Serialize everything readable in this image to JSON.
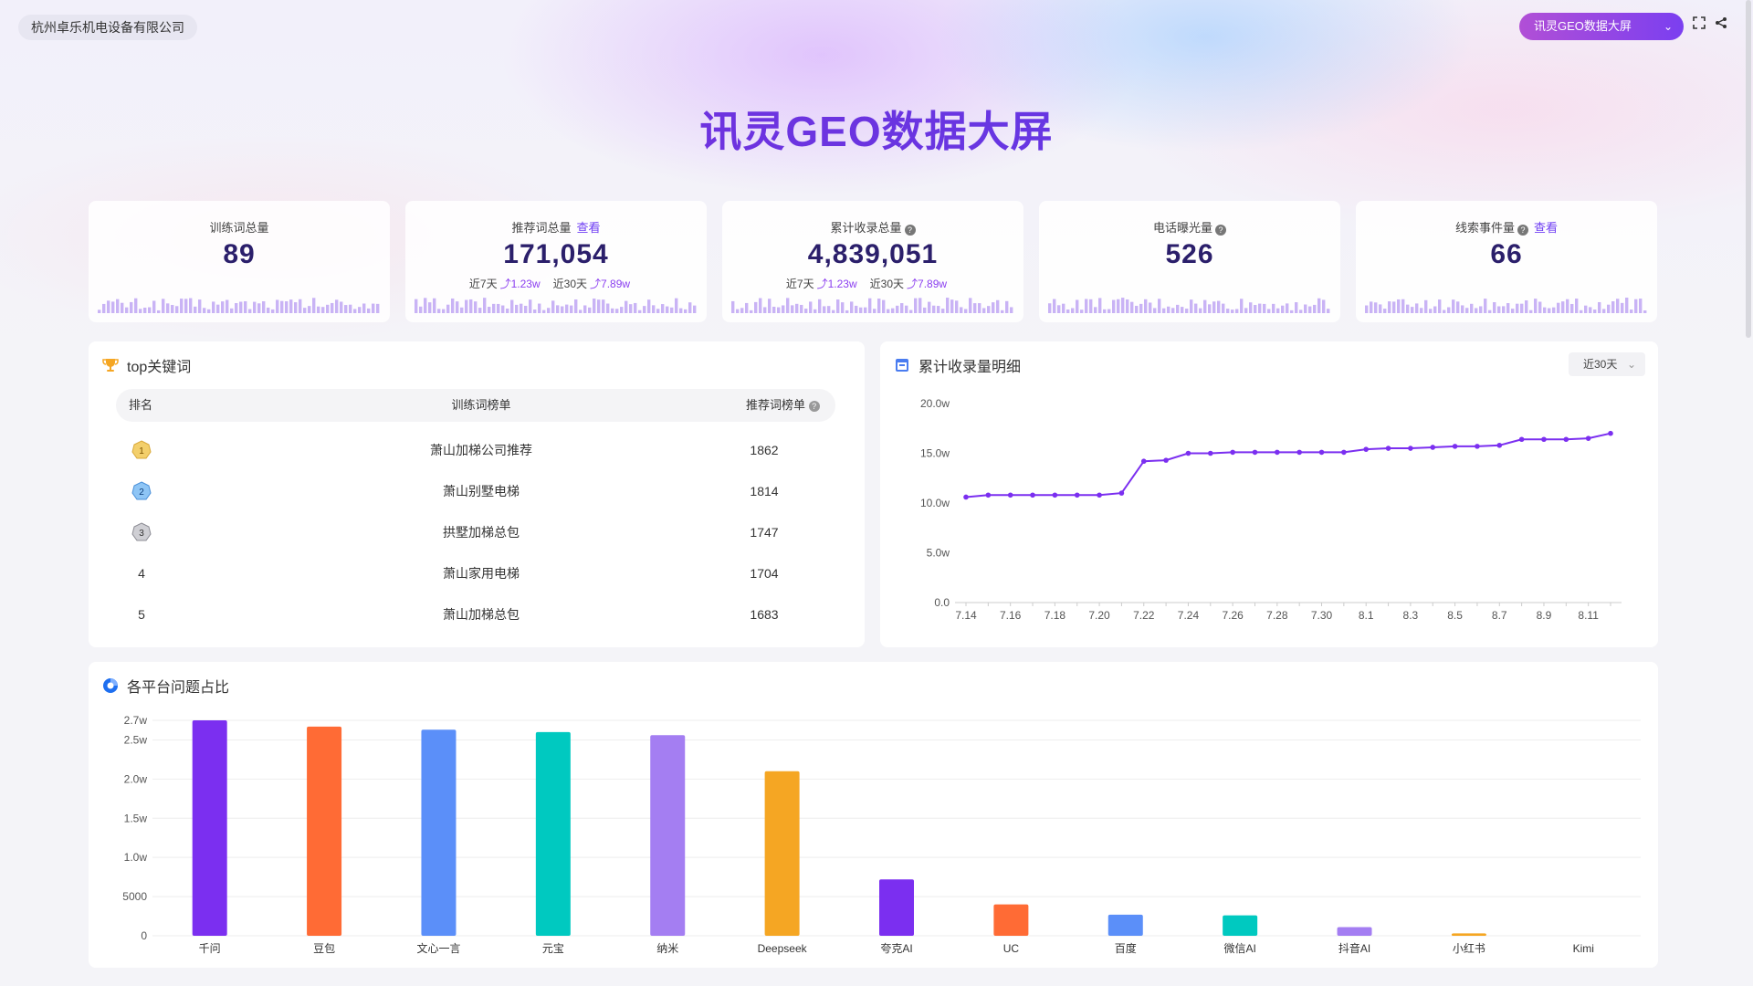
{
  "header": {
    "company": "杭州卓乐机电设备有限公司",
    "screen_select": "讯灵GEO数据大屏",
    "title": "讯灵GEO数据大屏"
  },
  "kpis": [
    {
      "label": "训练词总量",
      "value": "89",
      "link": "",
      "help": false,
      "trend": null
    },
    {
      "label": "推荐词总量",
      "value": "171,054",
      "link": "查看",
      "help": false,
      "trend": {
        "d7_label": "近7天",
        "d7_value": "1.23w",
        "d30_label": "近30天",
        "d30_value": "7.89w"
      }
    },
    {
      "label": "累计收录总量",
      "value": "4,839,051",
      "link": "",
      "help": true,
      "trend": {
        "d7_label": "近7天",
        "d7_value": "1.23w",
        "d30_label": "近30天",
        "d30_value": "7.89w"
      }
    },
    {
      "label": "电话曝光量",
      "value": "526",
      "link": "",
      "help": true,
      "trend": null
    },
    {
      "label": "线索事件量",
      "value": "66",
      "link": "查看",
      "help": true,
      "trend": null
    }
  ],
  "top_keywords": {
    "title": "top关键词",
    "columns": {
      "rank": "排名",
      "keyword": "训练词榜单",
      "count": "推荐词榜单"
    },
    "rows": [
      {
        "rank": "1",
        "keyword": "萧山加梯公司推荐",
        "count": "1862"
      },
      {
        "rank": "2",
        "keyword": "萧山别墅电梯",
        "count": "1814"
      },
      {
        "rank": "3",
        "keyword": "拱墅加梯总包",
        "count": "1747"
      },
      {
        "rank": "4",
        "keyword": "萧山家用电梯",
        "count": "1704"
      },
      {
        "rank": "5",
        "keyword": "萧山加梯总包",
        "count": "1683"
      }
    ]
  },
  "collection_panel": {
    "title": "累计收录量明细",
    "range": "近30天"
  },
  "platform_panel": {
    "title": "各平台问题占比"
  },
  "colors": {
    "accent": "#7b2ff0",
    "line": "#7b2ff0",
    "spark": "#c9b3f5"
  },
  "chart_data": [
    {
      "type": "line",
      "x": [
        "7.14",
        "7.15",
        "7.16",
        "7.17",
        "7.18",
        "7.19",
        "7.20",
        "7.21",
        "7.22",
        "7.23",
        "7.24",
        "7.25",
        "7.26",
        "7.27",
        "7.28",
        "7.29",
        "7.30",
        "7.31",
        "8.1",
        "8.2",
        "8.3",
        "8.4",
        "8.5",
        "8.6",
        "8.7",
        "8.8",
        "8.9",
        "8.10",
        "8.11",
        "8.12"
      ],
      "x_tick_labels": [
        "7.14",
        "7.16",
        "7.18",
        "7.20",
        "7.22",
        "7.24",
        "7.26",
        "7.28",
        "7.30",
        "8.1",
        "8.3",
        "8.5",
        "8.7",
        "8.9",
        "8.11"
      ],
      "series": [
        {
          "values": [
            10.6,
            10.8,
            10.8,
            10.8,
            10.8,
            10.8,
            10.8,
            11.0,
            14.2,
            14.3,
            15.0,
            15.0,
            15.1,
            15.1,
            15.1,
            15.1,
            15.1,
            15.1,
            15.4,
            15.5,
            15.5,
            15.6,
            15.7,
            15.7,
            15.8,
            16.4,
            16.4,
            16.4,
            16.5,
            17.0
          ]
        }
      ],
      "y_tick_labels": [
        "0.0",
        "5.0w",
        "10.0w",
        "15.0w",
        "20.0w"
      ],
      "ylim": [
        0,
        20
      ],
      "grid": false
    },
    {
      "type": "bar",
      "categories": [
        "千问",
        "豆包",
        "文心一言",
        "元宝",
        "纳米",
        "Deepseek",
        "夸克AI",
        "UC",
        "百度",
        "微信AI",
        "抖音AI",
        "小红书",
        "Kimi"
      ],
      "values": [
        27500,
        26700,
        26300,
        26000,
        25600,
        21000,
        7200,
        4000,
        2700,
        2600,
        1100,
        300,
        0
      ],
      "colors": [
        "#7b2ff0",
        "#ff6b35",
        "#5b8ff9",
        "#00c9c0",
        "#a47ef2",
        "#f5a623",
        "#7b2ff0",
        "#ff6b35",
        "#5b8ff9",
        "#00c9c0",
        "#a47ef2",
        "#f5a623",
        "#5b8ff9"
      ],
      "y_tick_labels": [
        "0",
        "5000",
        "1.0w",
        "1.5w",
        "2.0w",
        "2.5w",
        "2.7w"
      ],
      "ylim": [
        0,
        27500
      ],
      "grid": true
    }
  ]
}
